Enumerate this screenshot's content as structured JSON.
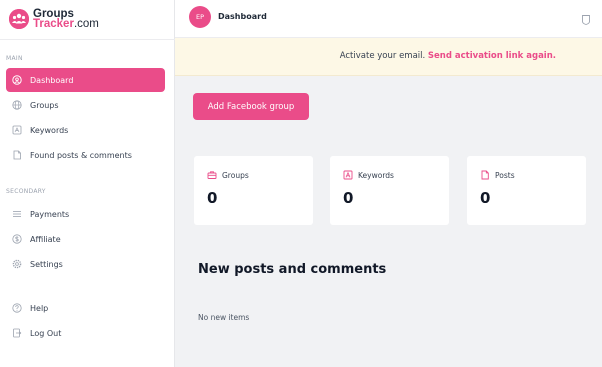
{
  "brand": {
    "line1": "Groups",
    "line2_accent": "Tracker",
    "line2_suffix": ".com"
  },
  "sidebar": {
    "main_label": "MAIN",
    "main_items": [
      {
        "label": "Dashboard",
        "icon": "dashboard-icon",
        "active": true
      },
      {
        "label": "Groups",
        "icon": "globe-icon"
      },
      {
        "label": "Keywords",
        "icon": "keyword-icon"
      },
      {
        "label": "Found posts & comments",
        "icon": "document-icon"
      }
    ],
    "secondary_label": "SECONDARY",
    "secondary_items": [
      {
        "label": "Payments",
        "icon": "list-icon"
      },
      {
        "label": "Affiliate",
        "icon": "dollar-icon"
      },
      {
        "label": "Settings",
        "icon": "gear-icon"
      }
    ],
    "bottom_items": [
      {
        "label": "Help",
        "icon": "help-icon"
      },
      {
        "label": "Log Out",
        "icon": "logout-icon"
      }
    ]
  },
  "topbar": {
    "avatar_initials": "EP",
    "title": "Dashboard",
    "notification_icon": "bell-icon"
  },
  "notice": {
    "message": "Activate your email. ",
    "link": "Send activation link again."
  },
  "main": {
    "primary_button": "Add Facebook group",
    "stats": [
      {
        "label": "Groups",
        "value": "0",
        "icon": "groups-stat-icon"
      },
      {
        "label": "Keywords",
        "value": "0",
        "icon": "keywords-stat-icon"
      },
      {
        "label": "Posts",
        "value": "0",
        "icon": "posts-stat-icon"
      }
    ],
    "section_title": "New posts and comments",
    "empty_text": "No new items"
  },
  "colors": {
    "accent": "#ea4c89",
    "notice_bg": "#fdf8e6",
    "content_bg": "#f1f2f4"
  }
}
